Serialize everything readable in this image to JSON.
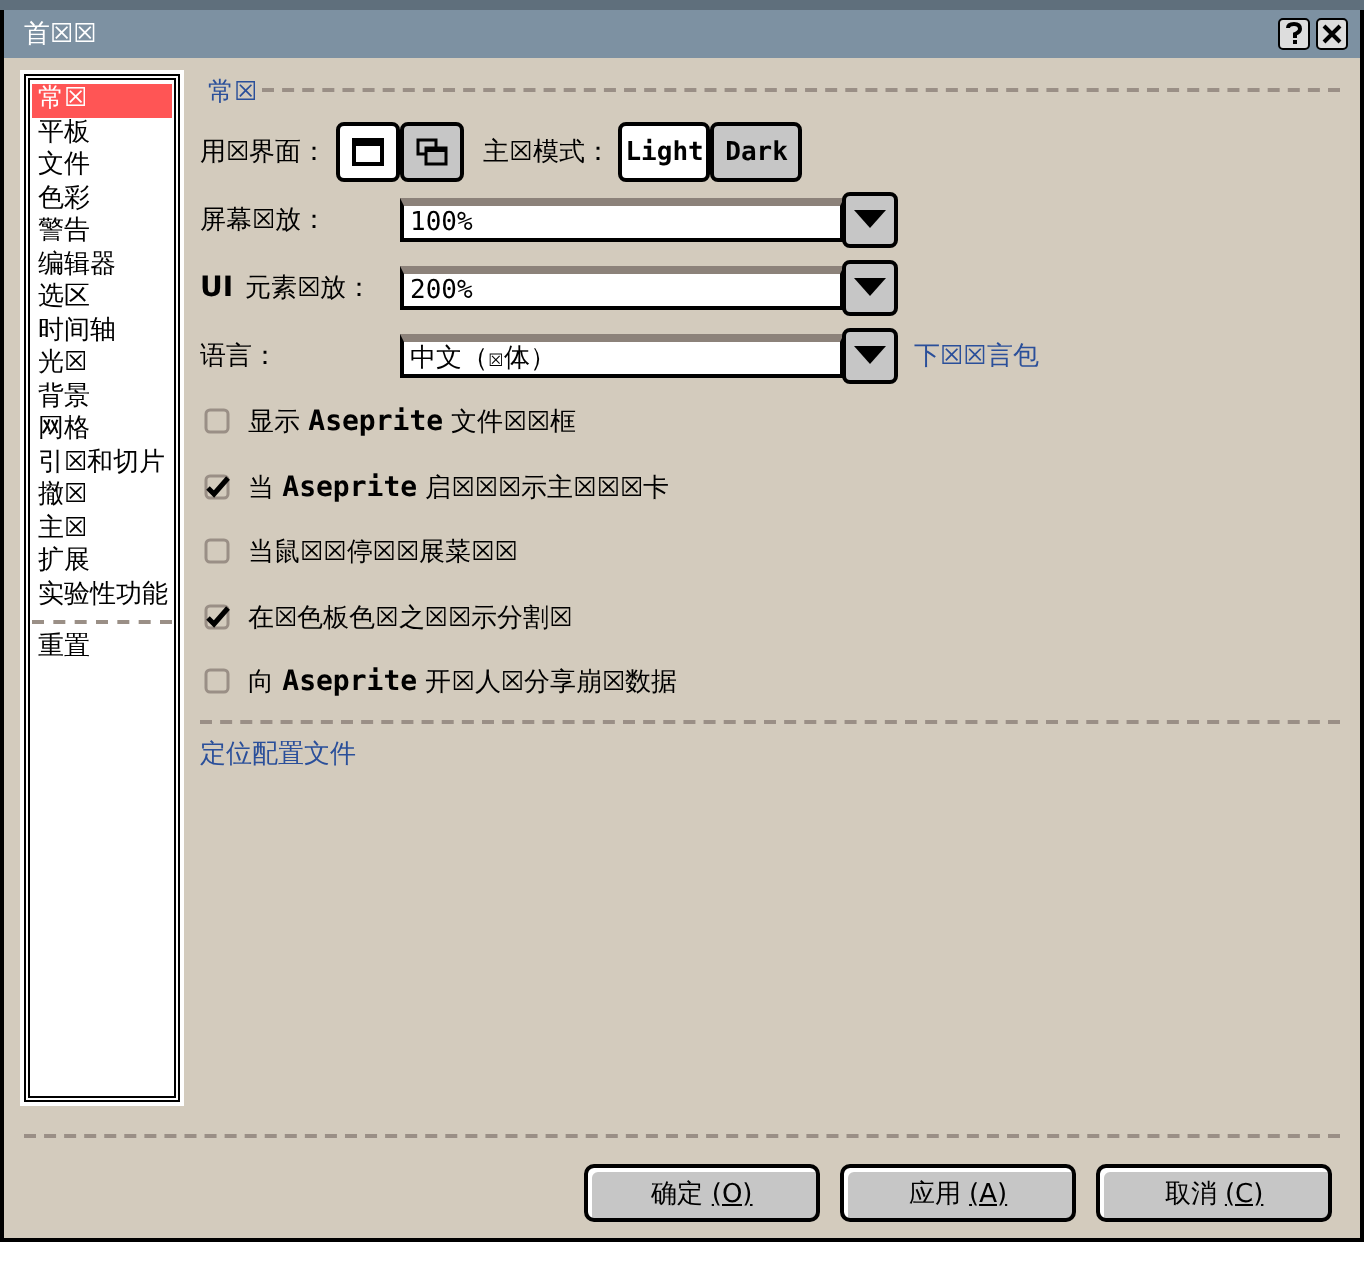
{
  "window": {
    "title": "首☒☒"
  },
  "sidebar": {
    "items": [
      {
        "label": "常☒",
        "selected": true
      },
      {
        "label": "平板",
        "selected": false
      },
      {
        "label": "文件",
        "selected": false
      },
      {
        "label": "色彩",
        "selected": false
      },
      {
        "label": "警告",
        "selected": false
      },
      {
        "label": "编辑器",
        "selected": false
      },
      {
        "label": "选区",
        "selected": false
      },
      {
        "label": "时间轴",
        "selected": false
      },
      {
        "label": "光☒",
        "selected": false
      },
      {
        "label": "背景",
        "selected": false
      },
      {
        "label": "网格",
        "selected": false
      },
      {
        "label": "引☒和切片",
        "selected": false
      },
      {
        "label": "撤☒",
        "selected": false
      },
      {
        "label": "主☒",
        "selected": false
      },
      {
        "label": "扩展",
        "selected": false
      },
      {
        "label": "实验性功能",
        "selected": false
      }
    ],
    "reset": "重置"
  },
  "section": {
    "title": "常☒"
  },
  "ui_mode": {
    "label": "用☒界面：",
    "options": [
      {
        "kind": "single",
        "selected": true
      },
      {
        "kind": "multi",
        "selected": false
      }
    ]
  },
  "theme_mode": {
    "label": "主☒模式：",
    "options": [
      {
        "label": "Light",
        "selected": true
      },
      {
        "label": "Dark",
        "selected": false
      }
    ]
  },
  "dropdowns": [
    {
      "label": "屏幕☒放：",
      "value": "100%"
    },
    {
      "label_prefix": "UI",
      "label": "元素☒放：",
      "value": "200%"
    },
    {
      "label": "语言：",
      "value": "中文（☒体）",
      "link": "下☒☒言包"
    }
  ],
  "checkboxes": [
    {
      "parts": [
        "显示",
        "Aseprite",
        "文件☒☒框"
      ],
      "checked": false
    },
    {
      "parts": [
        "当",
        "Aseprite",
        "启☒☒☒示主☒☒☒卡"
      ],
      "checked": true
    },
    {
      "parts": [
        "当鼠☒☒停☒☒展菜☒☒"
      ],
      "checked": false
    },
    {
      "parts": [
        "在☒色板色☒之☒☒示分割☒"
      ],
      "checked": true
    },
    {
      "parts": [
        "向",
        "Aseprite",
        "开☒人☒分享崩☒数据"
      ],
      "checked": false
    }
  ],
  "locate_link": "定位配置文件",
  "buttons": [
    {
      "label": "确定",
      "shortcut": "(O)"
    },
    {
      "label": "应用",
      "shortcut": "(A)"
    },
    {
      "label": "取消",
      "shortcut": "(C)"
    }
  ]
}
